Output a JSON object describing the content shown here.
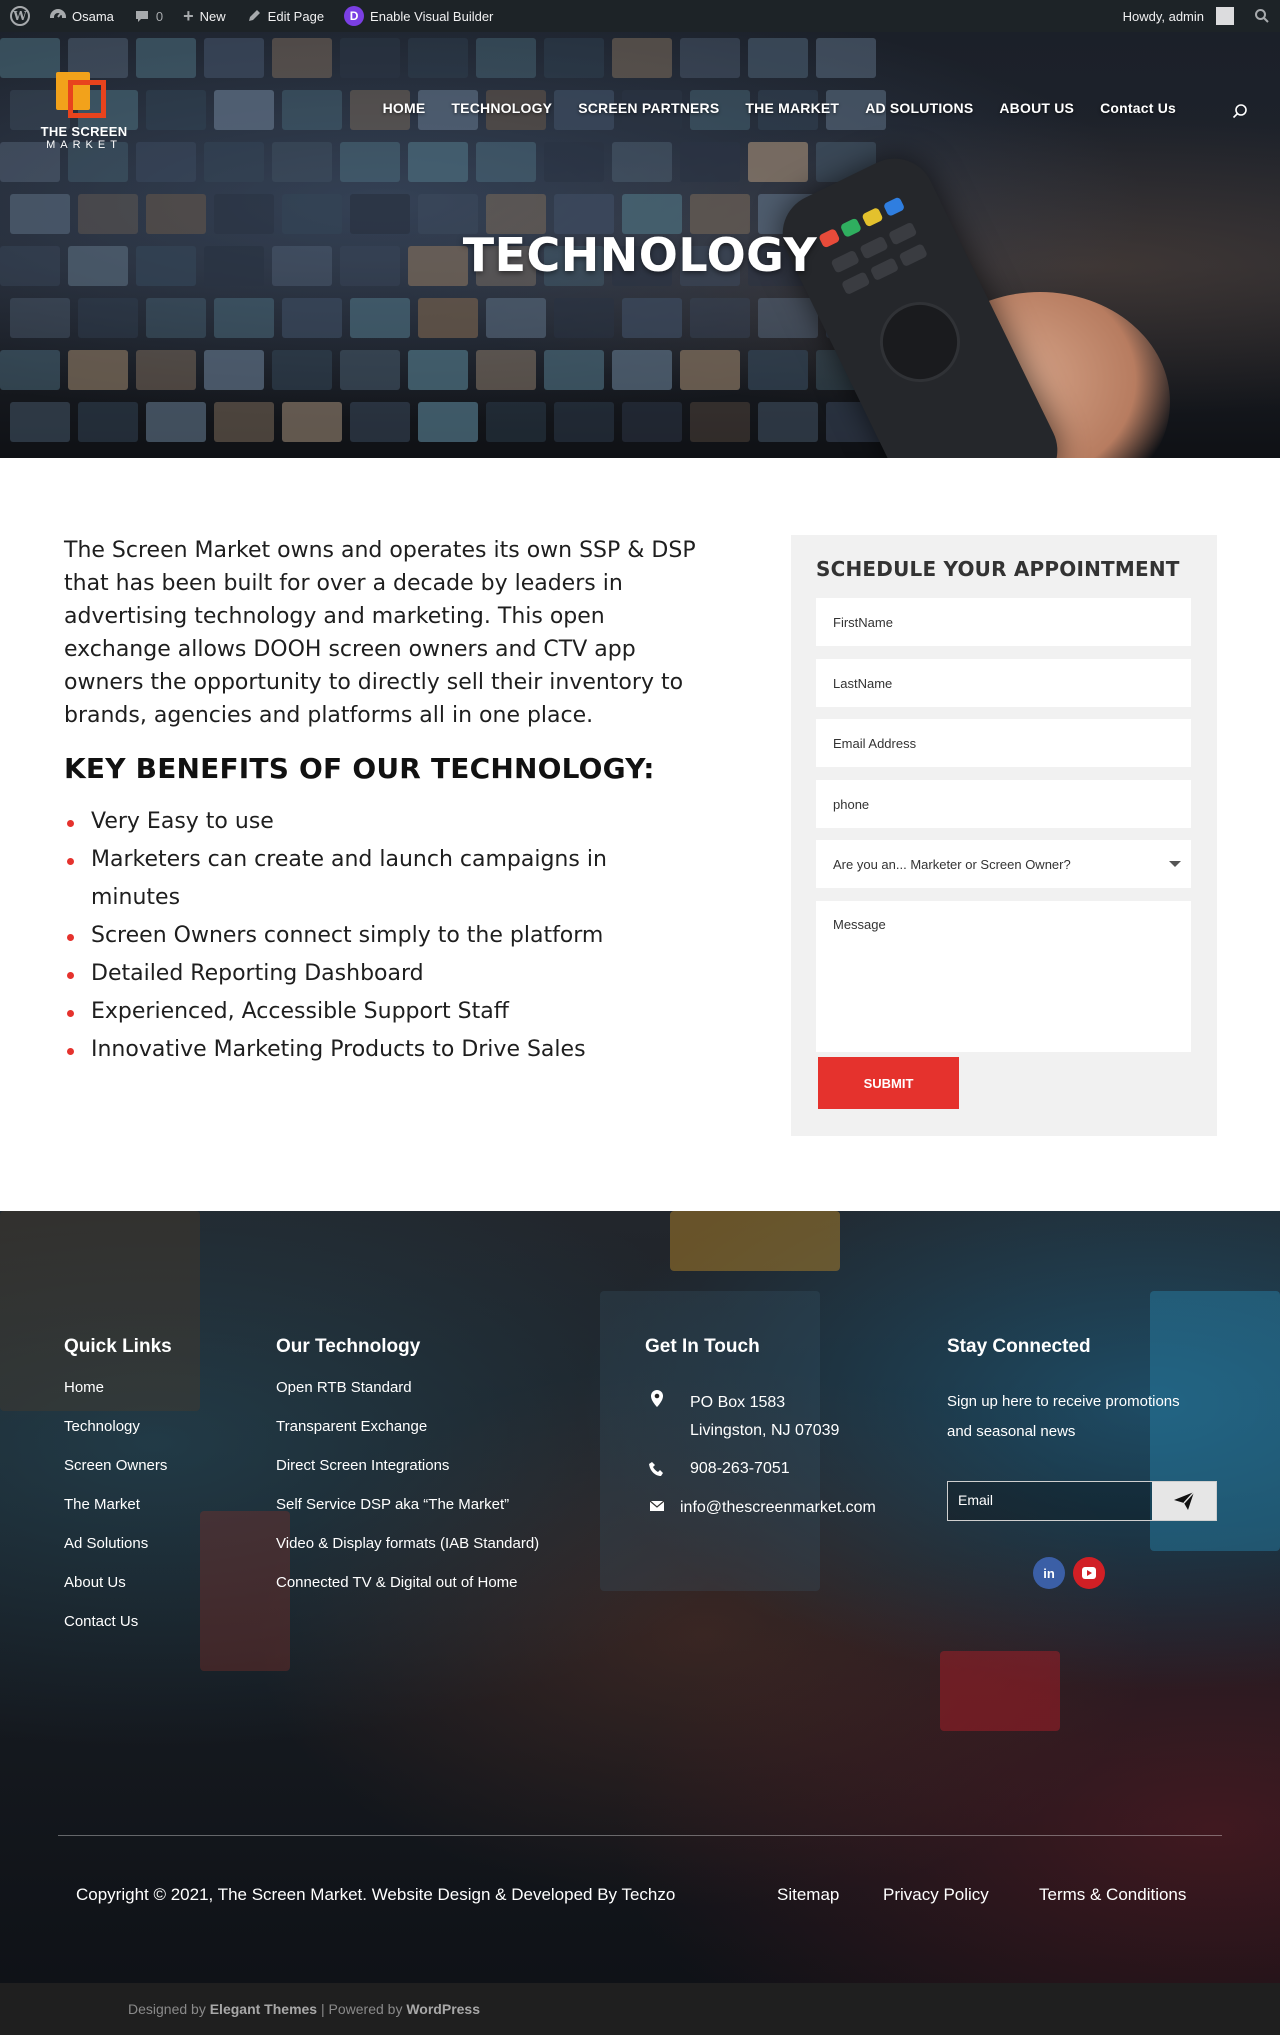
{
  "admin_bar": {
    "site_name": "Osama",
    "comments_count": "0",
    "new_label": "New",
    "edit_label": "Edit Page",
    "visual_builder_label": "Enable Visual Builder",
    "howdy": "Howdy, admin"
  },
  "header": {
    "logo_line1": "THE SCREEN",
    "logo_line2": "MARKET",
    "nav": [
      "HOME",
      "TECHNOLOGY",
      "SCREEN PARTNERS",
      "THE MARKET",
      "AD SOLUTIONS",
      "ABOUT US",
      "Contact Us"
    ]
  },
  "hero": {
    "title": "TECHNOLOGY"
  },
  "main": {
    "intro": "The Screen Market owns and operates its own SSP & DSP that has been built for over a decade by leaders in advertising technology and marketing. This open exchange allows DOOH screen owners and CTV app owners the opportunity to directly sell their inventory to brands, agencies and platforms all in one place.",
    "benefits_title": "KEY BENEFITS OF OUR TECHNOLOGY:",
    "benefits": [
      "Very Easy to use",
      "Marketers can create and launch campaigns in minutes",
      "Screen Owners connect simply to the platform",
      "Detailed Reporting Dashboard",
      "Experienced, Accessible Support Staff",
      "Innovative Marketing Products to Drive Sales"
    ]
  },
  "form": {
    "title": "SCHEDULE YOUR APPOINTMENT",
    "first_name": "FirstName",
    "last_name": "LastName",
    "email": "Email Address",
    "phone": "phone",
    "select_value": "Are you an... Marketer or Screen Owner?",
    "message": "Message",
    "submit": "SUBMIT"
  },
  "footer": {
    "quick_links_title": "Quick Links",
    "quick_links": [
      "Home",
      "Technology",
      "Screen Owners",
      "The Market",
      "Ad Solutions",
      "About Us",
      "Contact Us"
    ],
    "technology_title": "Our Technology",
    "technology_links": [
      "Open RTB Standard",
      "Transparent Exchange",
      "Direct Screen Integrations",
      "Self Service DSP aka “The Market”",
      "Video & Display formats (IAB Standard)",
      "Connected TV & Digital out of Home"
    ],
    "touch_title": "Get In Touch",
    "address_line1": "PO Box 1583",
    "address_line2": "Livingston, NJ 07039",
    "phone": "908-263-7051",
    "email": "info@thescreenmarket.com",
    "stay_title": "Stay Connected",
    "signup_text": "Sign up here to receive promotions and seasonal news",
    "email_placeholder": "Email",
    "copyright": "Copyright © 2021, The Screen Market. Website Design & Developed By Techzo",
    "bottom_links": [
      "Sitemap",
      "Privacy Policy",
      "Terms & Conditions"
    ]
  },
  "bottom_bar": {
    "designed_by": "Designed by",
    "elegant": "Elegant Themes",
    "powered": "| Powered by",
    "wordpress": "WordPress"
  },
  "colors": {
    "accent": "#e5322d",
    "admin_bar": "#1d2327",
    "form_bg": "#f1f1f1"
  }
}
